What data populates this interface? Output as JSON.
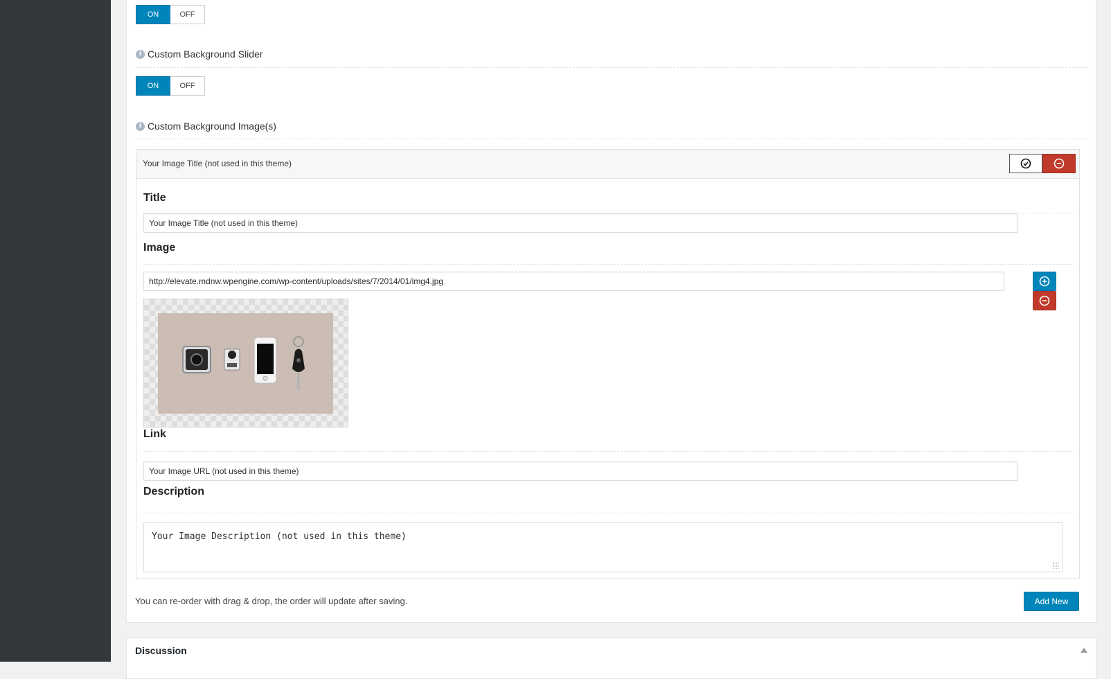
{
  "toggle1": {
    "on": "ON",
    "off": "OFF"
  },
  "slider_field": {
    "label": "Custom Background Slider"
  },
  "toggle2": {
    "on": "ON",
    "off": "OFF"
  },
  "images_field": {
    "label": "Custom Background Image(s)"
  },
  "slide": {
    "header_title": "Your Image Title (not used in this theme)",
    "title_label": "Title",
    "title_value": "Your Image Title (not used in this theme)",
    "image_label": "Image",
    "image_url": "http://elevate.mdnw.wpengine.com/wp-content/uploads/sites/7/2014/01/img4.jpg",
    "link_label": "Link",
    "link_value": "Your Image URL (not used in this theme)",
    "description_label": "Description",
    "description_value": "Your Image Description (not used in this theme)"
  },
  "footer": {
    "hint": "You can re-order with drag & drop, the order will update after saving.",
    "add_new": "Add New"
  },
  "discussion": {
    "title": "Discussion"
  },
  "colors": {
    "primary": "#0085ba",
    "danger": "#c0392b",
    "sidebar": "#32373c"
  }
}
